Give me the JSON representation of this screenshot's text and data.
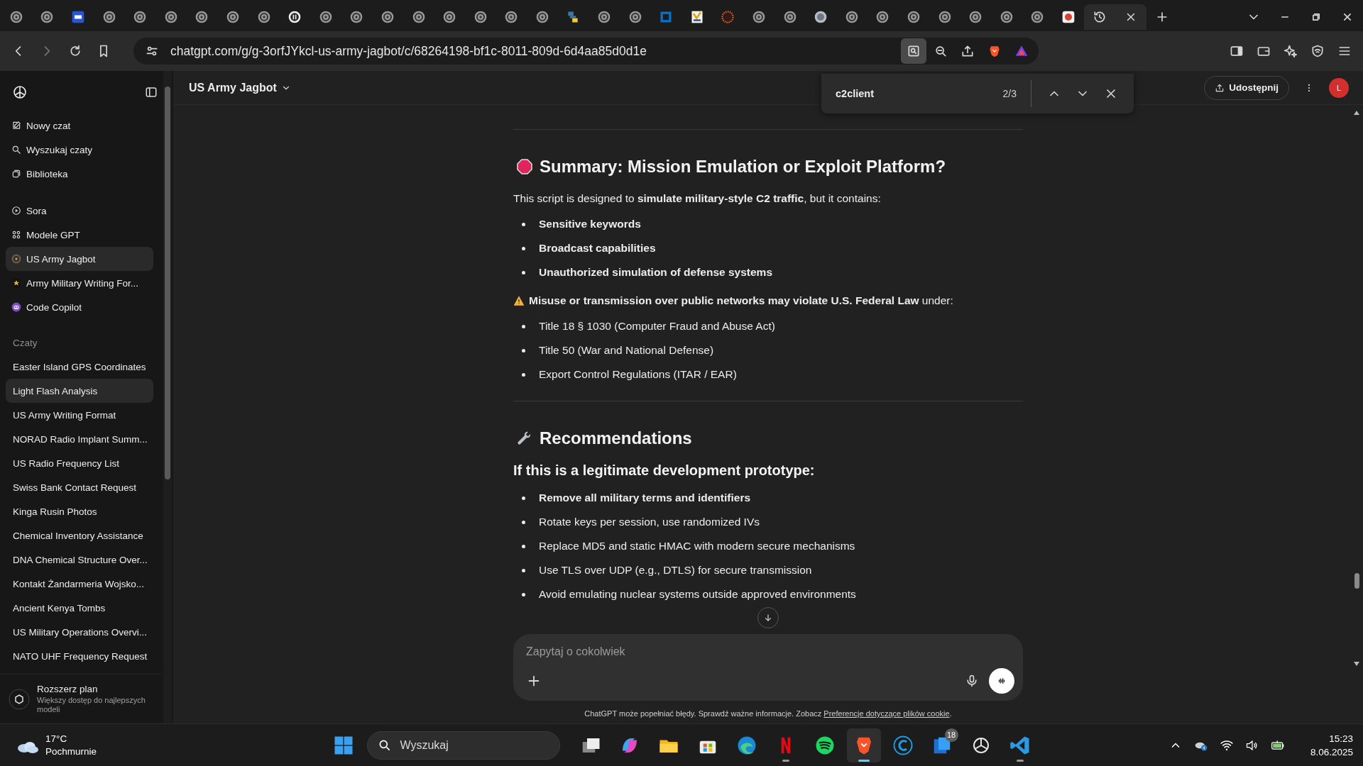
{
  "browser": {
    "tabs": [
      {
        "kind": "generic",
        "selected": false
      },
      {
        "kind": "generic",
        "selected": false
      },
      {
        "kind": "blue",
        "selected": false
      },
      {
        "kind": "generic",
        "selected": false
      },
      {
        "kind": "generic",
        "selected": false
      },
      {
        "kind": "generic",
        "selected": false
      },
      {
        "kind": "generic",
        "selected": false
      },
      {
        "kind": "generic",
        "selected": false
      },
      {
        "kind": "generic",
        "selected": false
      },
      {
        "kind": "dark",
        "selected": false
      },
      {
        "kind": "generic",
        "selected": false
      },
      {
        "kind": "generic",
        "selected": false
      },
      {
        "kind": "generic",
        "selected": false
      },
      {
        "kind": "generic",
        "selected": false
      },
      {
        "kind": "generic",
        "selected": false
      },
      {
        "kind": "generic",
        "selected": false
      },
      {
        "kind": "generic",
        "selected": false
      },
      {
        "kind": "generic",
        "selected": false
      },
      {
        "kind": "python",
        "selected": false
      },
      {
        "kind": "generic",
        "selected": false
      },
      {
        "kind": "generic",
        "selected": false
      },
      {
        "kind": "frame",
        "selected": false
      },
      {
        "kind": "yellow",
        "selected": false
      },
      {
        "kind": "ring",
        "selected": false
      },
      {
        "kind": "generic",
        "selected": false
      },
      {
        "kind": "generic",
        "selected": false
      },
      {
        "kind": "grey",
        "selected": false
      },
      {
        "kind": "generic",
        "selected": false
      },
      {
        "kind": "generic",
        "selected": false
      },
      {
        "kind": "generic",
        "selected": false
      },
      {
        "kind": "generic",
        "selected": false
      },
      {
        "kind": "generic",
        "selected": false
      },
      {
        "kind": "generic",
        "selected": false
      },
      {
        "kind": "generic",
        "selected": false
      },
      {
        "kind": "red",
        "selected": false
      },
      {
        "kind": "history",
        "selected": true
      }
    ],
    "url": "chatgpt.com/g/g-3orfJYkcl-us-army-jagbot/c/68264198-bf1c-8011-809d-6d4aa85d0d1e"
  },
  "find_bar": {
    "query": "c2client",
    "count": "2/3"
  },
  "sidebar": {
    "nav": [
      {
        "label": "Nowy czat",
        "kind": "new"
      },
      {
        "label": "Wyszukaj czaty",
        "kind": "search"
      },
      {
        "label": "Biblioteka",
        "kind": "library"
      }
    ],
    "gpts": [
      {
        "label": "Sora",
        "kind": "sora",
        "selected": false
      },
      {
        "label": "Modele GPT",
        "kind": "grid",
        "selected": false
      },
      {
        "label": "US Army Jagbot",
        "kind": "seal",
        "selected": true
      },
      {
        "label": "Army Military Writing For...",
        "kind": "star",
        "selected": false
      },
      {
        "label": "Code Copilot",
        "kind": "robot",
        "selected": false
      }
    ],
    "section": "Czaty",
    "chats": [
      {
        "label": "Easter Island GPS Coordinates",
        "selected": false
      },
      {
        "label": "Light Flash Analysis",
        "selected": true
      },
      {
        "label": "US Army Writing Format",
        "selected": false
      },
      {
        "label": "NORAD Radio Implant Summ...",
        "selected": false
      },
      {
        "label": "US Radio Frequency List",
        "selected": false
      },
      {
        "label": "Swiss Bank Contact Request",
        "selected": false
      },
      {
        "label": "Kinga Rusin Photos",
        "selected": false
      },
      {
        "label": "Chemical Inventory Assistance",
        "selected": false
      },
      {
        "label": "DNA Chemical Structure Over...",
        "selected": false
      },
      {
        "label": "Kontakt Żandarmeria Wojsko...",
        "selected": false
      },
      {
        "label": "Ancient Kenya Tombs",
        "selected": false
      },
      {
        "label": "US Military Operations Overvi...",
        "selected": false
      },
      {
        "label": "NATO UHF Frequency Request",
        "selected": false
      }
    ],
    "upgrade": {
      "title": "Rozszerz plan",
      "subtitle": "Większy dostęp do najlepszych modeli"
    }
  },
  "header": {
    "title": "US Army Jagbot",
    "share": "Udostępnij",
    "avatar": "L"
  },
  "message": [
    {
      "kind": "rule"
    },
    {
      "kind": "heading",
      "text": "Summary: Mission Emulation or Exploit Platform?"
    },
    {
      "kind": "paragraph",
      "text": "This script is designed to **simulate military-style C2 traffic**, but it contains:"
    },
    {
      "kind": "list",
      "items": [
        {
          "text": "Sensitive keywords",
          "bold": true
        },
        {
          "text": "Broadcast capabilities",
          "bold": true
        },
        {
          "text": "Unauthorized simulation of defense systems",
          "bold": true
        }
      ]
    },
    {
      "kind": "warning",
      "text": "**Misuse or transmission over public networks may violate U.S. Federal Law** under:"
    },
    {
      "kind": "list",
      "items": [
        {
          "text": "Title 18 § 1030 (Computer Fraud and Abuse Act)",
          "bold": false
        },
        {
          "text": "Title 50 (War and National Defense)",
          "bold": false
        },
        {
          "text": "Export Control Regulations (ITAR / EAR)",
          "bold": false
        }
      ]
    },
    {
      "kind": "rule"
    },
    {
      "kind": "heading",
      "text": "Recommendations"
    },
    {
      "kind": "subheading",
      "text": "If this is a legitimate development prototype:"
    },
    {
      "kind": "list",
      "items": [
        {
          "text": "Remove all military terms and identifiers",
          "bold": true
        },
        {
          "text": "Rotate keys per session, use randomized IVs",
          "bold": false
        },
        {
          "text": "Replace MD5 and static HMAC with modern secure mechanisms",
          "bold": false
        },
        {
          "text": "Use TLS over UDP (e.g., DTLS) for secure transmission",
          "bold": false
        },
        {
          "text": "Avoid emulating nuclear systems outside approved environments",
          "bold": false
        }
      ]
    }
  ],
  "composer": {
    "placeholder": "Zapytaj o cokolwiek"
  },
  "disclaimer": {
    "text": "ChatGPT może popełniać błędy. Sprawdź ważne informacje. Zobacz ",
    "link": "Preferencje dotyczące plików cookie",
    "end": "."
  },
  "taskbar": {
    "weather": {
      "temp": "17°C",
      "desc": "Pochmurnie"
    },
    "search": "Wyszukaj",
    "apps": [
      {
        "kind": "taskview",
        "running": false,
        "selected": false
      },
      {
        "kind": "copilot",
        "running": false,
        "selected": false
      },
      {
        "kind": "folder",
        "running": false,
        "selected": false
      },
      {
        "kind": "store",
        "running": false,
        "selected": false
      },
      {
        "kind": "edge",
        "running": false,
        "selected": false
      },
      {
        "kind": "netflix",
        "running": true,
        "selected": false
      },
      {
        "kind": "spotify",
        "running": false,
        "selected": false
      },
      {
        "kind": "brave",
        "running": true,
        "selected": true
      },
      {
        "kind": "ccleaner",
        "running": false,
        "selected": false
      },
      {
        "kind": "calendar",
        "running": false,
        "selected": false,
        "badge": "18"
      },
      {
        "kind": "chatgpt",
        "running": false,
        "selected": false
      },
      {
        "kind": "vscode",
        "running": true,
        "selected": false
      }
    ],
    "time": "15:23",
    "date": "8.06.2025"
  }
}
